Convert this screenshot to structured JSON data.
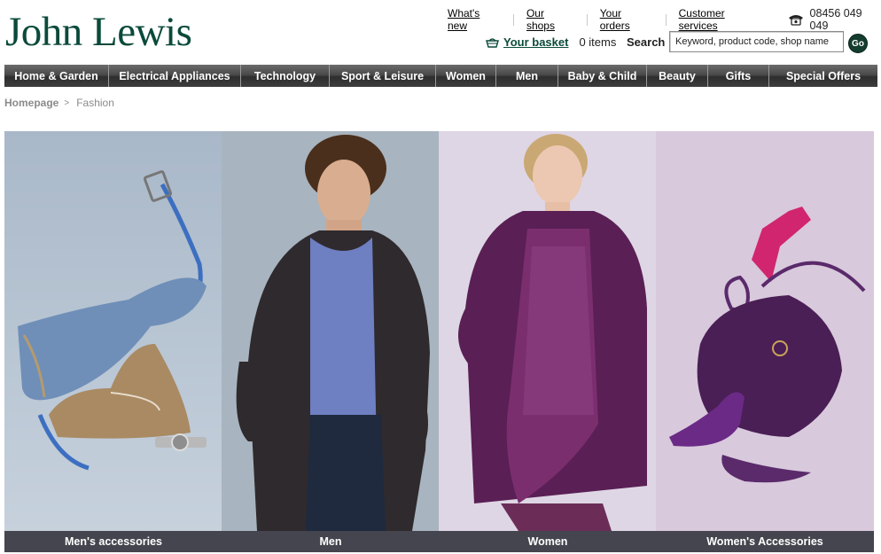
{
  "brand": {
    "logo_text": "John Lewis",
    "color": "#0b4a3b"
  },
  "utility_links": [
    "What's new",
    "Our shops",
    "Your orders",
    "Customer services"
  ],
  "phone": {
    "number": "08456 049 049",
    "icon": "telephone-icon"
  },
  "basket": {
    "label": "Your basket",
    "count": "0 items",
    "icon": "basket-icon"
  },
  "search": {
    "label": "Search",
    "placeholder": "Keyword, product code, shop name",
    "button": "Go"
  },
  "nav": [
    "Home & Garden",
    "Electrical Appliances",
    "Technology",
    "Sport & Leisure",
    "Women",
    "Men",
    "Baby & Child",
    "Beauty",
    "Gifts",
    "Special Offers"
  ],
  "breadcrumb": {
    "home": "Homepage",
    "current": "Fashion"
  },
  "panels": [
    {
      "caption": "Men's accessories",
      "bg": "#b9c7d6"
    },
    {
      "caption": "Men",
      "bg": "#a7b3bf"
    },
    {
      "caption": "Women",
      "bg": "#dbd4e3"
    },
    {
      "caption": "Women's Accessories",
      "bg": "#d9c9dc"
    }
  ],
  "colors": {
    "nav_bg": "#3a3a3a",
    "caption_bg": "#45454f",
    "go_button": "#143d2f"
  }
}
